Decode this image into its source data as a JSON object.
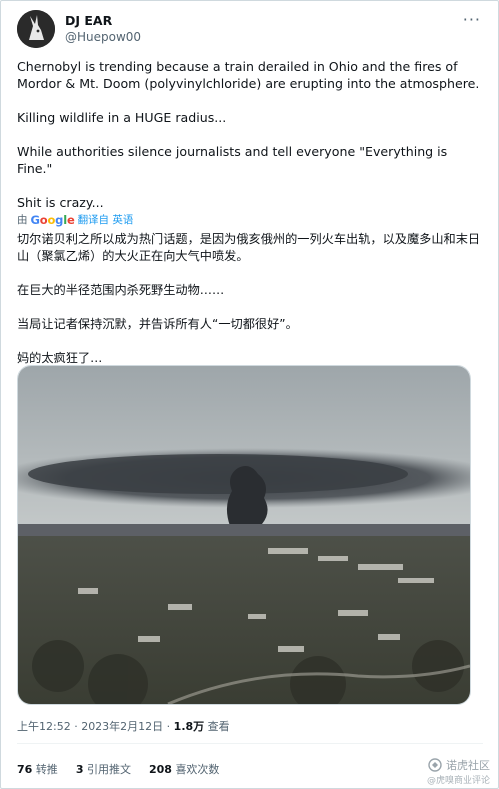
{
  "author": {
    "name": "DJ EAR",
    "handle": "@Huepow00"
  },
  "more_label": "···",
  "tweet": {
    "paragraphs": [
      "Chernobyl is trending because a train derailed in Ohio and the fires of Mordor & Mt. Doom (polyvinylchloride) are erupting into the atmosphere.",
      "Killing wildlife in a HUGE radius...",
      "While authorities silence journalists and tell everyone \"Everything is Fine.\"",
      "Shit is crazy..."
    ]
  },
  "translation": {
    "prefix": "由",
    "google_letters": [
      "G",
      "o",
      "o",
      "g",
      "l",
      "e"
    ],
    "action": "翻译自 英语",
    "paragraphs": [
      "切尔诺贝利之所以成为热门话题，是因为俄亥俄州的一列火车出轨，以及魔多山和末日山（聚氯乙烯）的大火正在向大气中喷发。",
      "在巨大的半径范围内杀死野生动物……",
      "当局让记者保持沉默，并告诉所有人“一切都很好”。",
      "妈的太疯狂了…"
    ]
  },
  "meta": {
    "time_date": "上午12:52 · 2023年2月12日 · ",
    "views_num": "1.8万",
    "views_label": " 查看"
  },
  "stats": {
    "retweets_num": "76",
    "retweets_label": "转推",
    "quotes_num": "3",
    "quotes_label": "引用推文",
    "likes_num": "208",
    "likes_label": "喜欢次数"
  },
  "watermark": {
    "line1": "诺虎社区",
    "line2": "@虎嗅商业评论"
  },
  "colors": {
    "link_blue": "#1d9bf0",
    "secondary_text": "#536471",
    "border": "#cfd9de"
  }
}
